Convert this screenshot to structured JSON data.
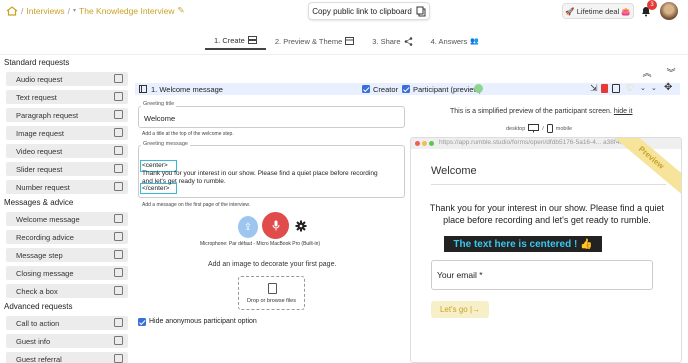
{
  "breadcrumb": {
    "sep1": "/",
    "interviews": "Interviews",
    "sep2": "/",
    "title": "The Knowledge Interview"
  },
  "header": {
    "copy_label": "Copy public link to clipboard",
    "lifetime_label": "Lifetime deal",
    "notif_count": "3"
  },
  "tabs": [
    {
      "label": "1. Create"
    },
    {
      "label": "2. Preview & Theme"
    },
    {
      "label": "3. Share"
    },
    {
      "label": "4. Answers"
    }
  ],
  "sidebar": {
    "standard_title": "Standard requests",
    "standard": [
      "Audio request",
      "Text request",
      "Paragraph request",
      "Image request",
      "Video request",
      "Slider request",
      "Number request"
    ],
    "messages_title": "Messages & advice",
    "messages": [
      "Welcome message",
      "Recording advice",
      "Message step",
      "Closing message",
      "Check a box"
    ],
    "advanced_title": "Advanced requests",
    "advanced": [
      "Call to action",
      "Guest info",
      "Guest referral"
    ]
  },
  "panel": {
    "title": "1. Welcome message",
    "creator_label": "Creator",
    "participant_label": "Participant (preview)"
  },
  "editor": {
    "greeting_title_label": "Greeting title",
    "greeting_title_value": "Welcome",
    "greeting_title_help": "Add a title at the top of the welcome step.",
    "greeting_message_label": "Greeting message",
    "code_line1": "<center>",
    "code_line2": "Thank you for your interest in our show. Please find a quiet place before recording",
    "code_line3": "and let's get ready to rumble.",
    "code_line4": "</center>",
    "greeting_message_help": "Add a message on the first page of the interview.",
    "microphone_label": "Microphone: Par défaut - Micro MacBook Pro (Built-in)",
    "image_label": "Add an image to decorate your first page.",
    "drop_label": "Drop or browse files",
    "hide_label": "Hide anonymous participant option"
  },
  "preview": {
    "note": "This is a simplified preview of the participant screen.",
    "hide_link": "hide it",
    "desktop": "desktop",
    "slash": "/",
    "mobile": "mobile",
    "url": "https://app.rumble.studio/forms/open/dfdb5176-5a16-4... a38f4fedc",
    "ribbon": "Preview",
    "title": "Welcome",
    "body": "Thank you for your interest in our show. Please find a quiet place before recording and let's get ready to rumble.",
    "highlight": "The text here is centered ! 👍",
    "email_label": "Your email *",
    "go_button": "Let's go |→"
  }
}
